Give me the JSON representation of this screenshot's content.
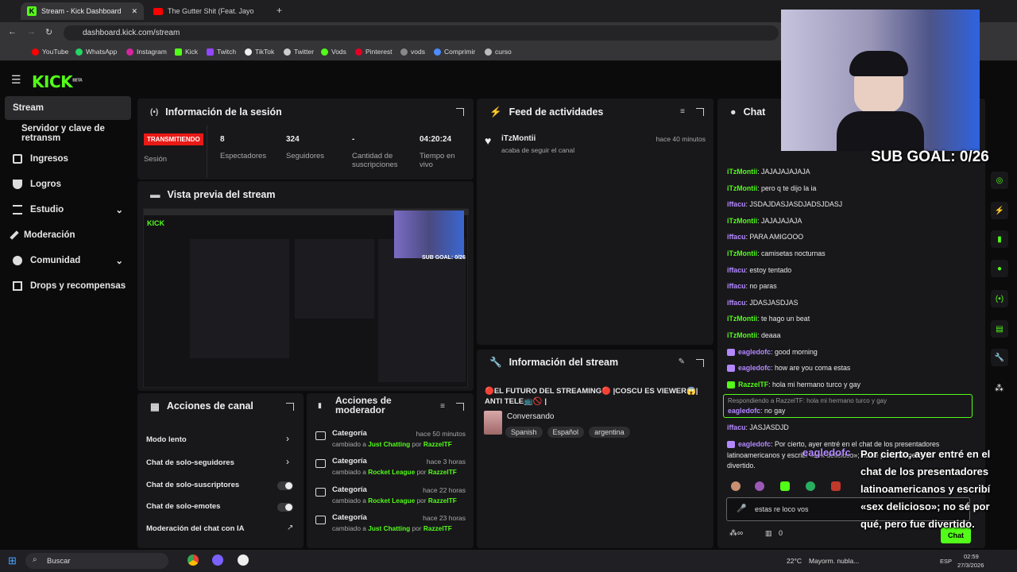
{
  "browser": {
    "tabs": [
      {
        "title": "Stream - Kick Dashboard"
      },
      {
        "title": "The Gutter Shit (Feat. Jayo"
      }
    ],
    "url": "dashboard.kick.com/stream",
    "bookmarks": [
      "YouTube",
      "WhatsApp",
      "Instagram",
      "Kick",
      "Twitch",
      "TikTok",
      "Twitter",
      "Vods",
      "Pinterest",
      "vods",
      "Comprimir",
      "curso"
    ]
  },
  "sidebar": {
    "items": [
      {
        "label": "Stream"
      },
      {
        "label": "Servidor y clave de retransm"
      },
      {
        "label": "Ingresos"
      },
      {
        "label": "Logros"
      },
      {
        "label": "Estudio"
      },
      {
        "label": "Moderación"
      },
      {
        "label": "Comunidad"
      },
      {
        "label": "Drops y recompensas"
      }
    ]
  },
  "session": {
    "title": "Información de la sesión",
    "badge": "TRANSMITIENDO",
    "session_label": "Sesión",
    "stats": [
      {
        "value": "8",
        "label": "Espectadores"
      },
      {
        "value": "324",
        "label": "Seguidores"
      },
      {
        "value": "-",
        "label": "Cantidad de suscripciones"
      },
      {
        "value": "04:20:24",
        "label": "Tiempo en vivo"
      }
    ]
  },
  "preview": {
    "title": "Vista previa del stream",
    "overlay": "SUB GOAL: 0/26"
  },
  "activity": {
    "title": "Feed de actividades",
    "items": [
      {
        "user": "iTzMontii",
        "action": "acaba de seguir el canal",
        "time": "hace 40 minutos"
      }
    ]
  },
  "stream_info": {
    "title": "Información del stream",
    "stream_title": "🔴EL FUTURO DEL STREAMING🔴 |COSCU ES VIEWER😱| ANTI TELE📺🚫 |",
    "category": "Conversando",
    "tags": [
      "Spanish",
      "Español",
      "argentina"
    ]
  },
  "channel_actions": {
    "title": "Acciones de canal",
    "items": [
      "Modo lento",
      "Chat de solo-seguidores",
      "Chat de solo-suscriptores",
      "Chat de solo-emotes",
      "Moderación del chat con IA"
    ]
  },
  "mod_actions": {
    "title": "Acciones de moderador",
    "items": [
      {
        "type": "Categoría",
        "time": "hace 50 minutos",
        "changed": "cambiado a",
        "cat": "Just Chatting",
        "by": "por",
        "user": "RazzelTF"
      },
      {
        "type": "Categoría",
        "time": "hace 3 horas",
        "changed": "cambiado a",
        "cat": "Rocket League",
        "by": "por",
        "user": "RazzelTF"
      },
      {
        "type": "Categoría",
        "time": "hace 22 horas",
        "changed": "cambiado a",
        "cat": "Rocket League",
        "by": "por",
        "user": "RazzelTF"
      },
      {
        "type": "Categoría",
        "time": "hace 23 horas",
        "changed": "cambiado a",
        "cat": "Just Chatting",
        "by": "por",
        "user": "RazzelTF"
      }
    ]
  },
  "chat": {
    "title": "Chat",
    "messages": [
      {
        "user": "iTzMontii",
        "text": ": JAJAJAJAJAJA",
        "color": "#53fc18"
      },
      {
        "user": "iTzMontii",
        "text": ": pero q te dijo la ia",
        "color": "#53fc18"
      },
      {
        "user": "iffacu",
        "text": ": JSDAJDASJASDJADSJDASJ",
        "color": "#b388ff"
      },
      {
        "user": "iTzMontii",
        "text": ": JAJAJAJAJA",
        "color": "#53fc18"
      },
      {
        "user": "iffacu",
        "text": ": PARA AMIGOOO",
        "color": "#b388ff"
      },
      {
        "user": "iTzMontii",
        "text": ": camisetas nocturnas",
        "color": "#53fc18"
      },
      {
        "user": "iffacu",
        "text": ": estoy tentado",
        "color": "#b388ff"
      },
      {
        "user": "iffacu",
        "text": ": no paras",
        "color": "#b388ff"
      },
      {
        "user": "iffacu",
        "text": ": JDASJASDJAS",
        "color": "#b388ff"
      },
      {
        "user": "iTzMontii",
        "text": ": te hago un beat",
        "color": "#53fc18"
      },
      {
        "user": "iTzMontii",
        "text": ": deaaa",
        "color": "#53fc18"
      },
      {
        "user": "eagledofc",
        "text": ": good morning",
        "color": "#b388ff"
      },
      {
        "user": "eagledofc",
        "text": ": how are you coma estas",
        "color": "#b388ff"
      },
      {
        "user": "RazzelTF",
        "text": ": hola mi hermano turco y gay",
        "color": "#53fc18"
      }
    ],
    "reply_to": "Respondiendo a RazzelTF: hola mi hermano turco y gay",
    "reply": {
      "user": "eagledofc",
      "text": ": no gay"
    },
    "after": [
      {
        "user": "iffacu",
        "text": ": JASJASDJD",
        "color": "#b388ff"
      },
      {
        "user": "eagledofc",
        "text": ": Por cierto, ayer entré en el chat de los presentadores",
        "color": "#b388ff"
      }
    ],
    "wrap1": "latinoamericanos y escribí «sex delicioso»; no sé por qué, pero fue",
    "wrap2": "divertido.",
    "input": "estas re loco vos",
    "send": "Chat",
    "counter": "0"
  },
  "overlay": {
    "sub_goal": "SUB GOAL: 0/26",
    "tts_user": "eagledofc",
    "tts_text": "Por cierto, ayer entré en el chat de los presentadores latinoamericanos y escribí «sex delicioso»; no sé por qué, pero fue divertido."
  },
  "taskbar": {
    "search": "Buscar",
    "weather": "22°C",
    "weather_desc": "Mayorm. nubla...",
    "lang": "ESP",
    "time": "02:59",
    "date": "27/3/2026"
  }
}
